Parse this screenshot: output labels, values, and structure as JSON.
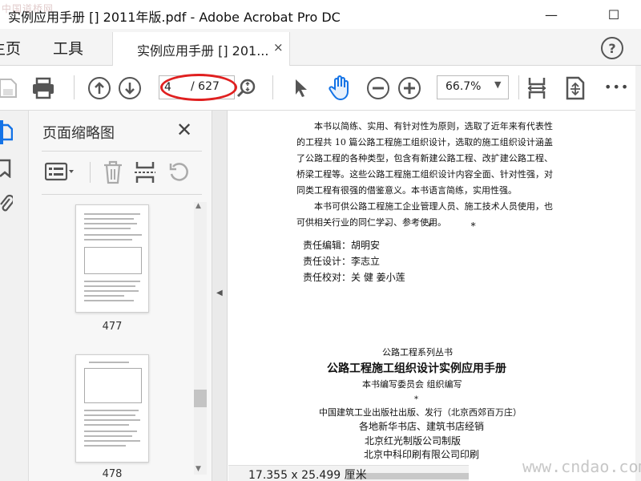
{
  "window": {
    "title": "实例应用手册 [] 2011年版.pdf - Adobe Acrobat Pro DC",
    "watermark_tl": "中国道桥网",
    "minimize": "—",
    "maximize": "☐"
  },
  "tabs": {
    "home": "主页",
    "tools": "工具",
    "document": "实例应用手册 [] 201...",
    "close": "×",
    "help": "?"
  },
  "toolbar": {
    "page_current": "4",
    "page_total": "/ 627",
    "zoom": "66.7%",
    "more": "•••"
  },
  "thumbnails": {
    "title": "页面缩略图",
    "close": "✕",
    "pages": [
      {
        "label": "477"
      },
      {
        "label": "478"
      }
    ]
  },
  "document": {
    "paragraphs": [
      "本书以简练、实用、有针对性为原则，选取了近年来有代表性的工程共 10 篇公路工程施工组织设计，选取的施工组织设计涵盖了公路工程的各种类型，包含有新建公路工程、改扩建公路工程、桥梁工程等。这些公路工程施工组织设计内容全面、针对性强，对同类工程有很强的借鉴意义。本书语言简练，实用性强。",
      "本书可供公路工程施工企业管理人员、施工技术人员使用，也可供相关行业的同仁学习、参考使用。"
    ],
    "stars": "* * *",
    "credits": [
      "责任编辑：胡明安",
      "责任设计：李志立",
      "责任校对：关   健   姜小莲"
    ],
    "series": "公路工程系列丛书",
    "book_title": "公路工程施工组织设计实例应用手册",
    "editor": "本书编写委员会   组织编写",
    "star2": "*",
    "publisher": "中国建筑工业出版社出版、发行（北京西郊百万庄）",
    "distribution": "各地新华书店、建筑书店经销",
    "maker": "北京红光制版公司制版",
    "printer": "北京中科印刷有限公司印刷"
  },
  "status": {
    "page_size": "17.355 x 25.499 厘米"
  },
  "watermark_br": "www.cndao.com",
  "colors": {
    "accent": "#1473e6",
    "highlight_oval": "#e02020"
  }
}
